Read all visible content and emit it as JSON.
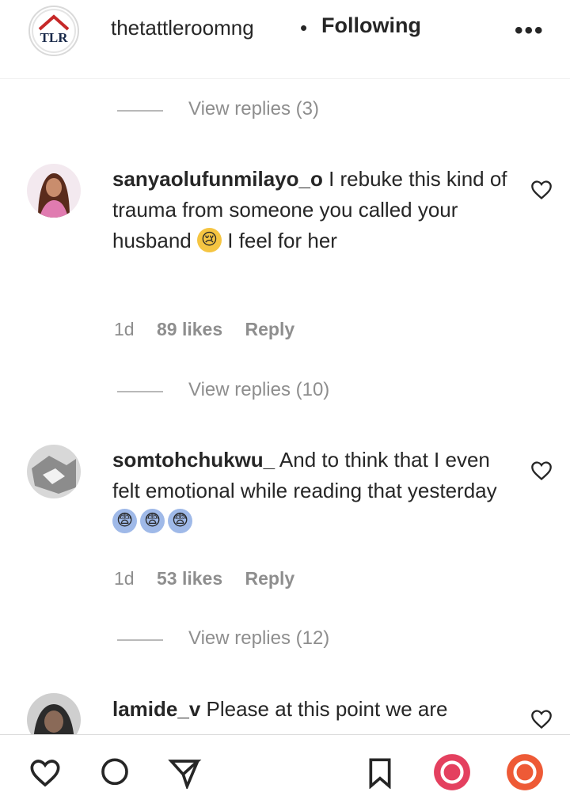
{
  "header": {
    "username": "thetattleroomng",
    "separator": "•",
    "follow_label": "Following",
    "logo_text": "TLR",
    "more_icon": "more-options-icon"
  },
  "threads": [
    {
      "view_replies": "View replies (3)"
    }
  ],
  "comments": [
    {
      "username": "sanyaolufunmilayo_o",
      "text_before": " I rebuke this kind of trauma from someone you called your husband ",
      "text_after": " I feel for her",
      "emoji": "😢",
      "time": "1d",
      "likes": "89 likes",
      "reply_label": "Reply",
      "view_replies": "View replies (10)"
    },
    {
      "username": "somtohchukwu_",
      "text_before": " And to think that I even felt emotional while reading that yesterday ",
      "text_after": "",
      "emoji": "😨",
      "time": "1d",
      "likes": "53 likes",
      "reply_label": "Reply",
      "view_replies": "View replies (12)"
    },
    {
      "username": "lamide_v",
      "text_before": " Please at this point we are",
      "text_after": ""
    }
  ],
  "colors": {
    "text": "#262626",
    "secondary": "#8e8e8e",
    "divider": "#dbdbdb"
  }
}
